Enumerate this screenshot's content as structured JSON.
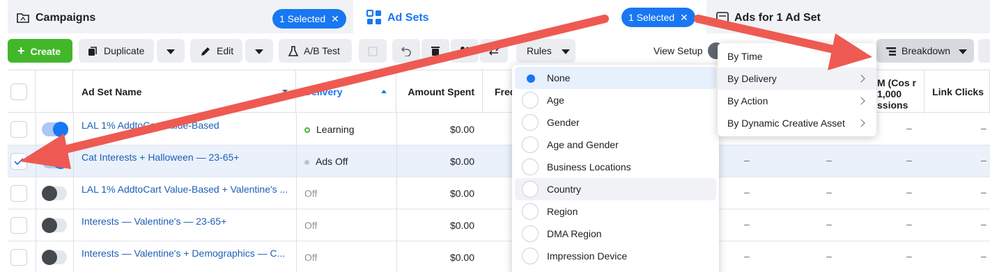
{
  "tabs": {
    "campaigns": {
      "label": "Campaigns",
      "selected": "1 Selected"
    },
    "adsets": {
      "label": "Ad Sets",
      "selected": "1 Selected"
    },
    "ads": {
      "label": "Ads for 1 Ad Set"
    }
  },
  "toolbar": {
    "create": "Create",
    "duplicate": "Duplicate",
    "edit": "Edit",
    "abtest": "A/B Test",
    "rules": "Rules",
    "view_setup": "View Setup",
    "breakdown": "Breakdown"
  },
  "columns": {
    "name": "Ad Set Name",
    "delivery": "Delivery",
    "amount_spent": "Amount Spent",
    "frequency": "Freq",
    "cpm": "M (Cos r 1,000 ssions",
    "link_clicks": "Link Clicks"
  },
  "rows": [
    {
      "name": "LAL 1% AddtoCart Value-Based",
      "delivery": "Learning",
      "spent": "$0.00",
      "checked": false,
      "on": true
    },
    {
      "name": "Cat Interests + Halloween — 23-65+",
      "delivery": "Ads Off",
      "spent": "$0.00",
      "checked": true,
      "on": true
    },
    {
      "name": "LAL 1% AddtoCart Value-Based + Valentine's ...",
      "delivery": "Off",
      "spent": "$0.00",
      "checked": false,
      "on": false
    },
    {
      "name": "Interests — Valentine's — 23-65+",
      "delivery": "Off",
      "spent": "$0.00",
      "checked": false,
      "on": false
    },
    {
      "name": "Interests — Valentine's + Demographics — C...",
      "delivery": "Off",
      "spent": "$0.00",
      "checked": false,
      "on": false
    }
  ],
  "dash": "–",
  "breakdown_options": [
    "None",
    "Age",
    "Gender",
    "Age and Gender",
    "Business Locations",
    "Country",
    "Region",
    "DMA Region",
    "Impression Device"
  ],
  "breakdown_selected": "None",
  "breakdown_categories": [
    "By Time",
    "By Delivery",
    "By Action",
    "By Dynamic Creative Asset"
  ],
  "colors": {
    "accent": "#1877f2",
    "create": "#42b72a",
    "arrow": "#ee5a52",
    "link": "#1c5fb5",
    "learning": "#42b72a"
  }
}
